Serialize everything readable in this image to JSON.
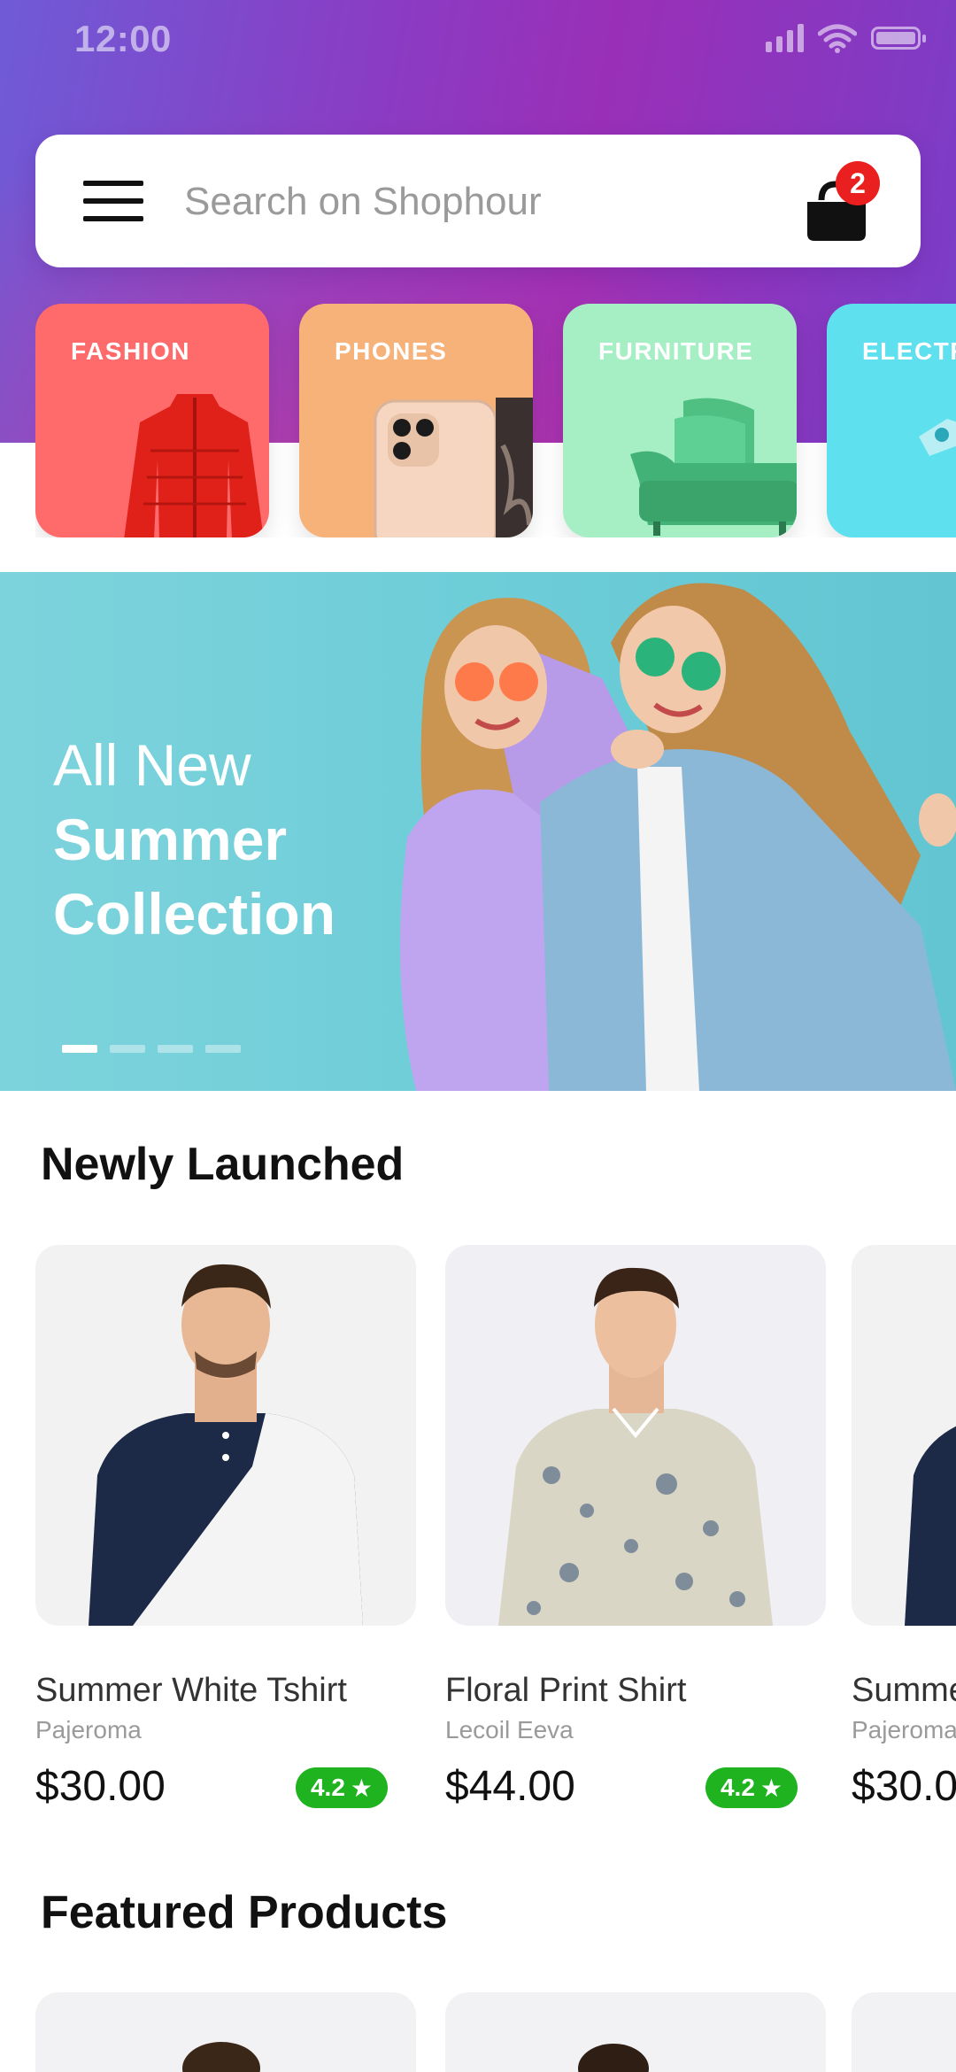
{
  "status_bar": {
    "time": "12:00",
    "icons": [
      "signal-icon",
      "wifi-icon",
      "battery-icon"
    ]
  },
  "search": {
    "placeholder": "Search on Shophour",
    "cart_count": "2"
  },
  "categories": [
    {
      "label": "FASHION",
      "color": "#ff6b6b",
      "icon": "jacket-icon"
    },
    {
      "label": "PHONES",
      "color": "#f7b27a",
      "icon": "phone-icon"
    },
    {
      "label": "FURNITURE",
      "color": "#a6eec4",
      "icon": "sofa-icon"
    },
    {
      "label": "ELECTR",
      "color": "#5fe0ef",
      "icon": "electronics-icon"
    }
  ],
  "banner": {
    "line1": "All New",
    "line2": "Summer",
    "line3": "Collection",
    "slide_count": 4,
    "active_slide": 1
  },
  "newly_launched": {
    "title": "Newly Launched",
    "products": [
      {
        "name": "Summer White Tshirt",
        "brand": "Pajeroma",
        "price": "$30.00",
        "rating": "4.2"
      },
      {
        "name": "Floral Print Shirt",
        "brand": "Lecoil Eeva",
        "price": "$44.00",
        "rating": "4.2"
      },
      {
        "name": "Summe",
        "brand": "Pajeroma",
        "price": "$30.0",
        "rating": ""
      }
    ]
  },
  "featured_products": {
    "title": "Featured Products"
  },
  "colors": {
    "accent_purple": "#8a3cc4",
    "badge_red": "#ea1f1f",
    "rating_green": "#1fb31f",
    "banner_teal": "#6ccdd8"
  }
}
